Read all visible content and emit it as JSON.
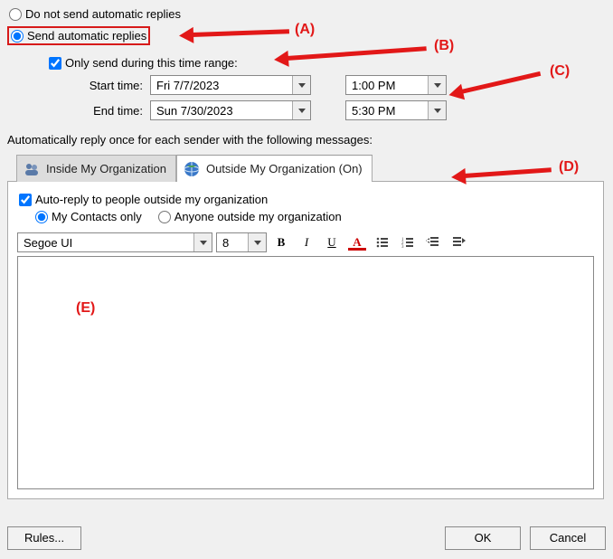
{
  "radios": {
    "do_not_send": "Do not send automatic replies",
    "send": "Send automatic replies"
  },
  "time_range": {
    "only_send": "Only send during this time range:",
    "start_label": "Start time:",
    "start_date": "Fri 7/7/2023",
    "start_time": "1:00 PM",
    "end_label": "End time:",
    "end_date": "Sun 7/30/2023",
    "end_time": "5:30 PM"
  },
  "instruction": "Automatically reply once for each sender with the following messages:",
  "tabs": {
    "inside": "Inside My Organization",
    "outside": "Outside My Organization (On)"
  },
  "outside_opts": {
    "auto_reply": "Auto-reply to people outside my organization",
    "contacts_only": "My Contacts only",
    "anyone": "Anyone outside my organization"
  },
  "format_bar": {
    "font": "Segoe UI",
    "size": "8"
  },
  "buttons": {
    "rules": "Rules...",
    "ok": "OK",
    "cancel": "Cancel"
  },
  "annotations": {
    "a": "(A)",
    "b": "(B)",
    "c": "(C)",
    "d": "(D)",
    "e": "(E)"
  }
}
